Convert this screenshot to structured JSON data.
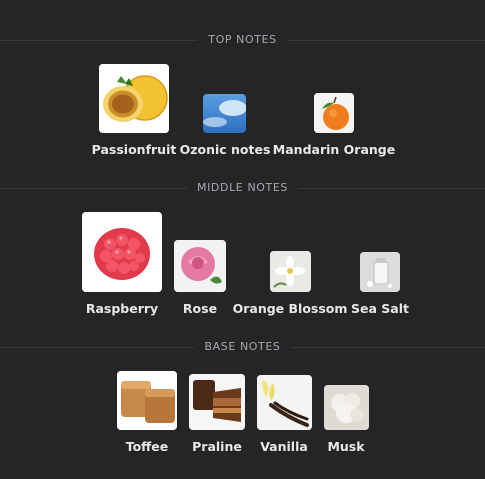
{
  "sections": {
    "top": {
      "title": "TOP NOTES",
      "notes": [
        {
          "label": "Passionfruit",
          "icon": "passionfruit-image"
        },
        {
          "label": "Ozonic notes",
          "icon": "ozonic-sky-image"
        },
        {
          "label": "Mandarin Orange",
          "icon": "mandarin-orange-image"
        }
      ]
    },
    "middle": {
      "title": "MIDDLE NOTES",
      "notes": [
        {
          "label": "Raspberry",
          "icon": "raspberry-image"
        },
        {
          "label": "Rose",
          "icon": "rose-image"
        },
        {
          "label": "Orange Blossom",
          "icon": "orange-blossom-image"
        },
        {
          "label": "Sea Salt",
          "icon": "sea-salt-image"
        }
      ]
    },
    "base": {
      "title": "BASE NOTES",
      "notes": [
        {
          "label": "Toffee",
          "icon": "toffee-image"
        },
        {
          "label": "Praline",
          "icon": "praline-image"
        },
        {
          "label": "Vanilla",
          "icon": "vanilla-image"
        },
        {
          "label": "Musk",
          "icon": "musk-image"
        }
      ]
    }
  }
}
